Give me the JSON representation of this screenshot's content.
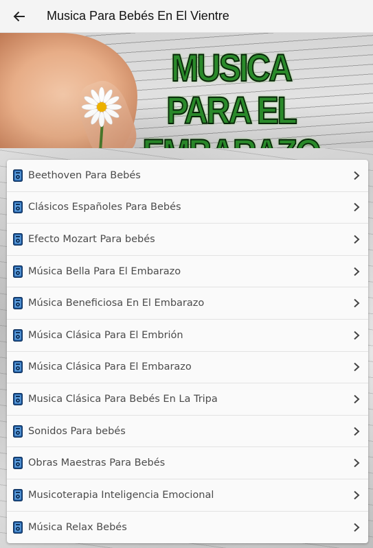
{
  "app_bar": {
    "title": "Musica Para Bebés En El Vientre",
    "back_icon": "arrow-left-icon"
  },
  "banner": {
    "line1": "MUSICA PARA EL",
    "line2": "EMBARAZO",
    "text_color": "#2a8a2a"
  },
  "list": {
    "item_icon": "music-player-icon",
    "chevron_icon": "chevron-right-icon",
    "items": [
      {
        "label": "Beethoven Para Bebés"
      },
      {
        "label": "Clásicos Españoles Para Bebés"
      },
      {
        "label": "Efecto Mozart Para bebés"
      },
      {
        "label": "Música Bella Para El Embarazo"
      },
      {
        "label": "Música Beneficiosa En El Embarazo"
      },
      {
        "label": "Música Clásica Para El Embrión"
      },
      {
        "label": "Música Clásica Para El Embarazo"
      },
      {
        "label": "Musica Clásica Para Bebés En La Tripa"
      },
      {
        "label": "Sonidos Para bebés"
      },
      {
        "label": "Obras Maestras Para Bebés"
      },
      {
        "label": "Musicoterapia Inteligencia Emocional"
      },
      {
        "label": "Música Relax Bebés"
      }
    ]
  }
}
